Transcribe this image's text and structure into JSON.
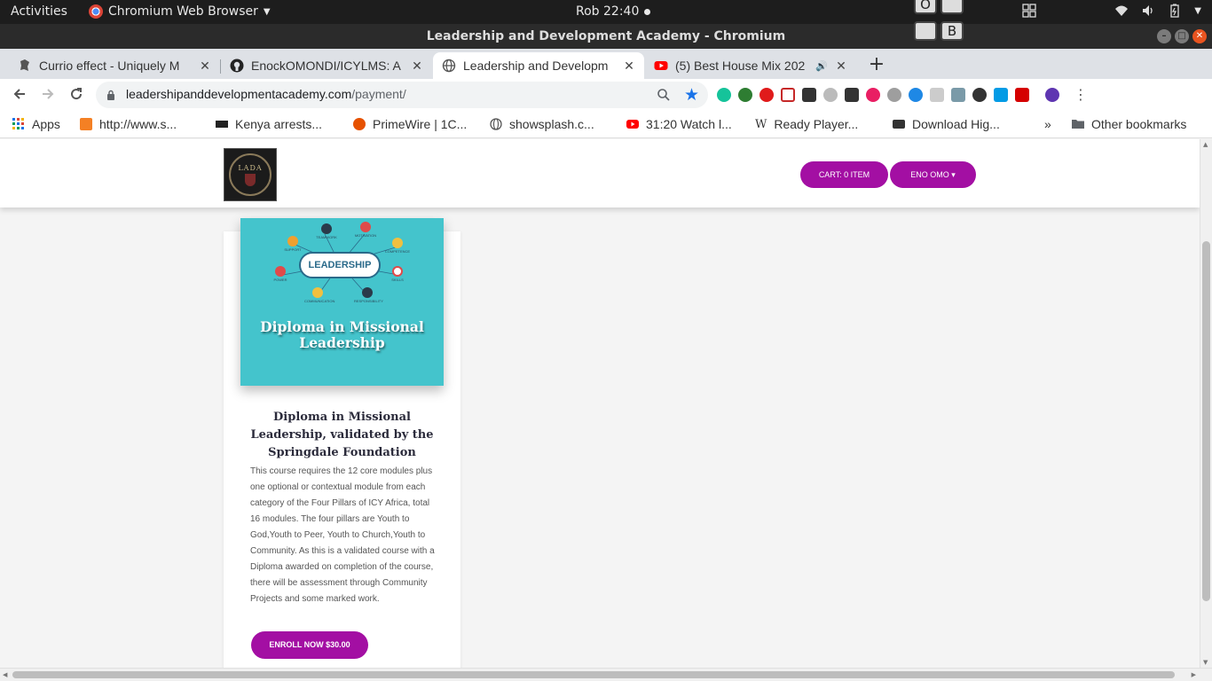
{
  "system_bar": {
    "activities": "Activities",
    "app_name": "Chromium Web Browser",
    "clock": "Rob 22:40",
    "keycap_top": "O",
    "keycap_bottom": "B"
  },
  "window": {
    "title": "Leadership and Development Academy - Chromium"
  },
  "tabs": [
    {
      "label": "Currio effect - Uniquely M",
      "icon": "currio-favicon-icon"
    },
    {
      "label": "EnockOMONDI/ICYLMS: A",
      "icon": "github-icon"
    },
    {
      "label": "Leadership and Developm",
      "icon": "globe-icon",
      "active": true
    },
    {
      "label": "(5) Best House Mix 202",
      "icon": "youtube-icon",
      "audio": "🔊"
    }
  ],
  "tab_close_glyph": "✕",
  "new_tab_glyph": "+",
  "toolbar": {
    "url_host": "leadershipanddevelopmentacademy.com",
    "url_path": "/payment/"
  },
  "bookmarks": {
    "apps": "Apps",
    "items": [
      "http://www.s...",
      "Kenya arrests...",
      "PrimeWire | 1C...",
      "showsplash.c...",
      "31:20 Watch l...",
      "Ready Player...",
      "Download Hig..."
    ],
    "overflow": "»",
    "other": "Other bookmarks"
  },
  "site": {
    "logo_text": "LADA",
    "cart_button": "CART: 0 ITEM",
    "user_button": "ENO OMO ▾"
  },
  "course": {
    "image_center": "LEADERSHIP",
    "image_title": "Diploma in Missional Leadership",
    "image_nodes": [
      "TEAMWORK",
      "MOTIVATION",
      "SUPPORT",
      "COMPETENCE",
      "POWER",
      "SKILLS",
      "COMMUNICATION",
      "RESPONSIBILITY"
    ],
    "title": "Diploma in Missional Leadership, validated by the Springdale Foundation",
    "description": "This course requires the 12 core modules plus one optional or contextual module from each category of the Four Pillars of ICY Africa, total 16 modules. The four pillars are Youth to God,Youth to Peer, Youth to Church,Youth to Community. As this is a validated course with a Diploma awarded on completion of the course, there will be assessment through Community Projects and some marked work.",
    "enroll_button": "ENROLL NOW $30.00"
  },
  "colors": {
    "accent": "#a30fa3",
    "image_bg": "#44c4cc",
    "chrome_blue": "#1a73e8"
  }
}
